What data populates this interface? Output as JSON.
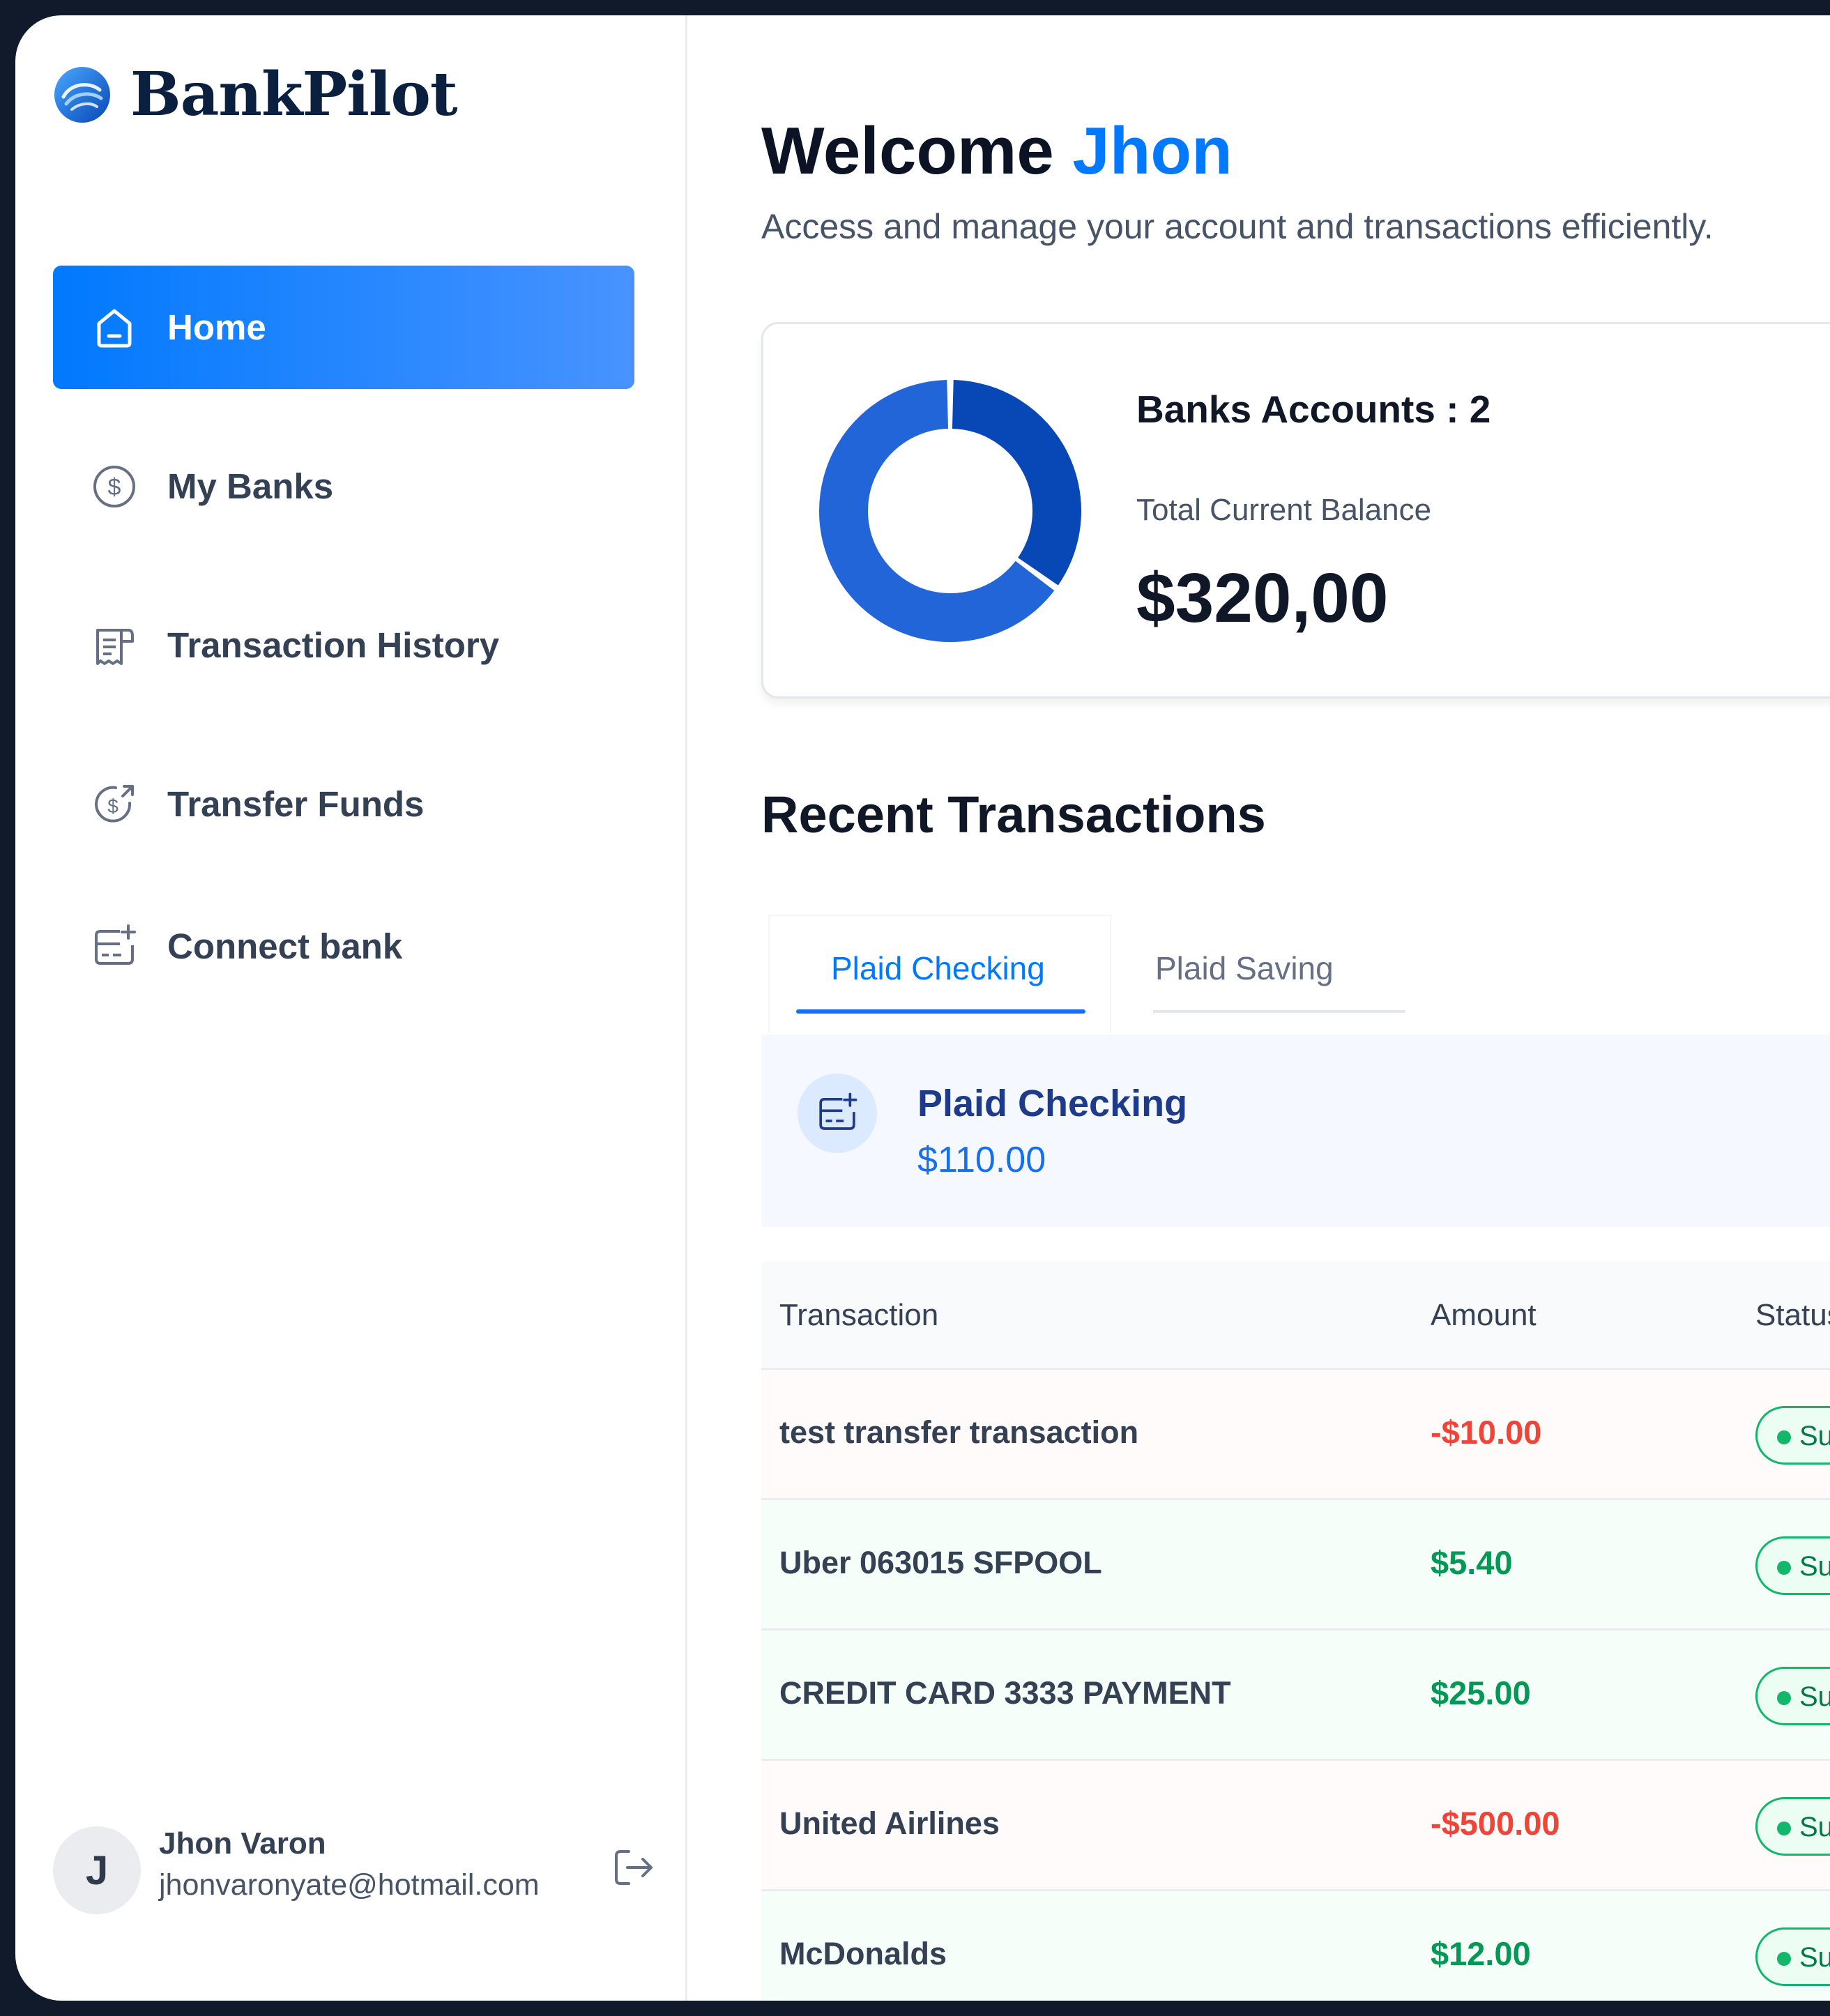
{
  "app": {
    "brand": "BankPilot"
  },
  "sidebar": {
    "items": [
      {
        "label": "Home",
        "icon": "home-icon",
        "active": true
      },
      {
        "label": "My Banks",
        "icon": "dollar-circle-icon"
      },
      {
        "label": "Transaction History",
        "icon": "receipt-icon"
      },
      {
        "label": "Transfer Funds",
        "icon": "money-send-icon"
      },
      {
        "label": "Connect bank",
        "icon": "card-add-icon"
      }
    ],
    "user": {
      "initial": "J",
      "name": "Jhon Varon",
      "email": "jhonvaronyate@hotmail.com"
    }
  },
  "header": {
    "welcome_prefix": "Welcome",
    "user_first_name": "Jhon",
    "subtitle": "Access and manage your account and transactions efficiently."
  },
  "balance": {
    "accounts_label": "Banks Accounts : 2",
    "total_label": "Total Current Balance",
    "total_value": "$320,00",
    "donut_share": 0.35,
    "colors": {
      "primary": "#0747b6",
      "secondary": "#2265d8"
    }
  },
  "recent": {
    "title": "Recent Transactions",
    "tabs": [
      {
        "label": "Plaid Checking",
        "active": true
      },
      {
        "label": "Plaid Saving",
        "active": false
      }
    ],
    "account": {
      "name": "Plaid Checking",
      "amount": "$110.00"
    },
    "table": {
      "headers": [
        "Transaction",
        "Amount",
        "Status"
      ],
      "rows": [
        {
          "name": "test transfer transaction",
          "amount": "-$10.00",
          "type": "debit",
          "status": "Suc"
        },
        {
          "name": "Uber 063015 SFPOOL",
          "amount": "$5.40",
          "type": "credit",
          "status": "Suc"
        },
        {
          "name": "CREDIT CARD 3333 PAYMENT",
          "amount": "$25.00",
          "type": "credit",
          "status": "Suc"
        },
        {
          "name": "United Airlines",
          "amount": "-$500.00",
          "type": "debit",
          "status": "Suc"
        },
        {
          "name": "McDonalds",
          "amount": "$12.00",
          "type": "credit",
          "status": "Suc"
        }
      ]
    }
  },
  "colors": {
    "accent": "#0179fe",
    "debit": "#f04438",
    "credit": "#039855",
    "success": "#12b76a"
  }
}
